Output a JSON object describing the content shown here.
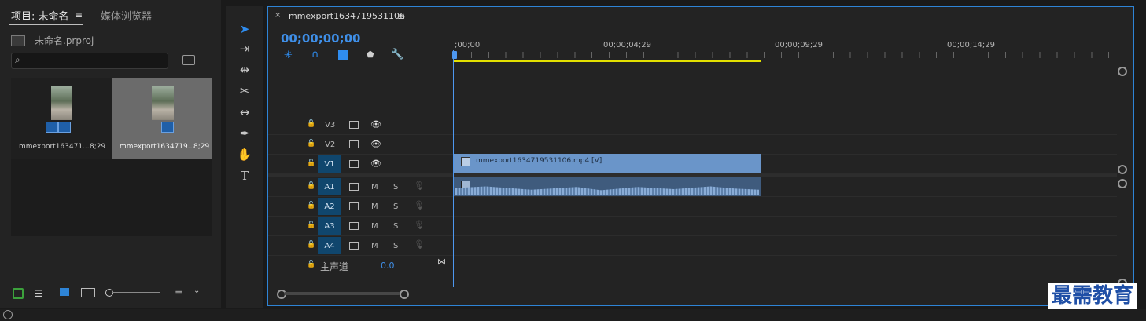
{
  "project_panel": {
    "tab_project": "项目: 未命名",
    "tab_media": "媒体浏览器",
    "project_file": "未命名.prproj",
    "items": [
      {
        "name": "mmexport163471...",
        "duration": "8;29"
      },
      {
        "name": "mmexport1634719...",
        "duration": "8;29"
      }
    ]
  },
  "timeline": {
    "tab_title": "mmexport1634719531106",
    "timecode": "00;00;00;00",
    "ruler": [
      ";00;00",
      "00;00;04;29",
      "00;00;09;29",
      "00;00;14;29"
    ],
    "video_tracks": [
      {
        "id": "V3"
      },
      {
        "id": "V2"
      },
      {
        "id": "V1"
      }
    ],
    "audio_tracks": [
      {
        "id": "A1",
        "m": "M",
        "s": "S"
      },
      {
        "id": "A2",
        "m": "M",
        "s": "S"
      },
      {
        "id": "A3",
        "m": "M",
        "s": "S"
      },
      {
        "id": "A4",
        "m": "M",
        "s": "S"
      }
    ],
    "master": {
      "label": "主声道",
      "value": "0.0"
    },
    "video_clip": "mmexport1634719531106.mp4 [V]"
  },
  "watermark": "最需教育",
  "colors": {
    "accent": "#2e84d6",
    "timecode": "#3f8fe8",
    "video_clip": "#6a95c9",
    "audio_clip": "#3f5b7d",
    "in_out": "#e2e000"
  }
}
